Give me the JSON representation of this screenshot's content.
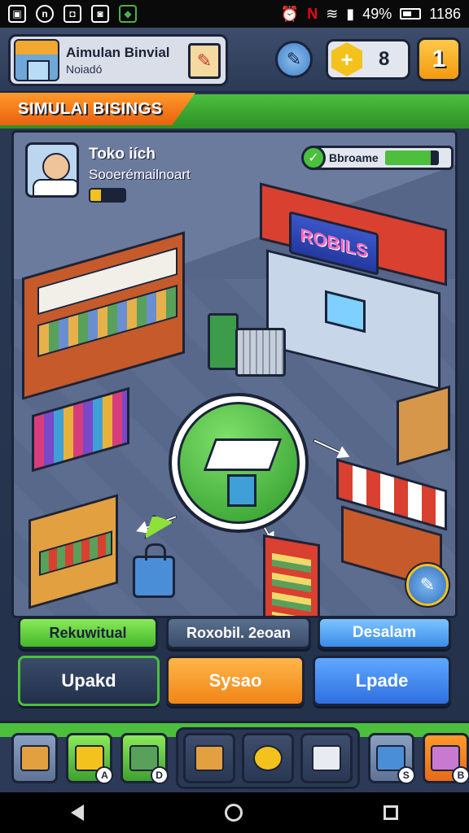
{
  "status_bar": {
    "battery_text": "49%",
    "time": "1186",
    "icons": [
      "gallery-icon",
      "n-app-icon",
      "briefcase-icon",
      "messenger-icon",
      "android-game-icon",
      "alarm-icon",
      "netflix-icon",
      "wifi-icon",
      "signal-icon",
      "battery-icon"
    ],
    "n_icon_label": "n"
  },
  "header": {
    "title": "Aimulan Binvial",
    "subtitle": "Noiadó",
    "gem_count": "8",
    "level": "1",
    "gem_symbol": "+"
  },
  "banner": {
    "label": "SIMULAI BISINGS"
  },
  "profile": {
    "name": "Toko iích",
    "role": "Sooerémailnoart",
    "level_fill_percent": 30
  },
  "progress": {
    "label": "Bbroame",
    "fill_percent": 85
  },
  "shop": {
    "sign_text": "ROBILS"
  },
  "actions": {
    "row1": [
      "Rekuwitual",
      "Roxobil. 2eoan",
      "Desalam"
    ],
    "row2": [
      "Upakd",
      "Sysao",
      "Lpade"
    ]
  },
  "tray": {
    "items": [
      {
        "name": "box-icon",
        "badge": ""
      },
      {
        "name": "coin-stack-icon",
        "badge": "A"
      },
      {
        "name": "cash-stack-icon",
        "badge": "D"
      },
      {
        "name": "package-icon",
        "badge": ""
      },
      {
        "name": "phone-icon",
        "badge": ""
      },
      {
        "name": "bottle-icon",
        "badge": ""
      },
      {
        "name": "fabric-stack-icon",
        "badge": "S"
      },
      {
        "name": "gift-icon",
        "badge": "B"
      }
    ]
  },
  "colors": {
    "accent_green": "#4cbf3d",
    "accent_orange": "#f08516",
    "accent_blue": "#2f6fe0",
    "panel_dark": "#2c3a57"
  }
}
